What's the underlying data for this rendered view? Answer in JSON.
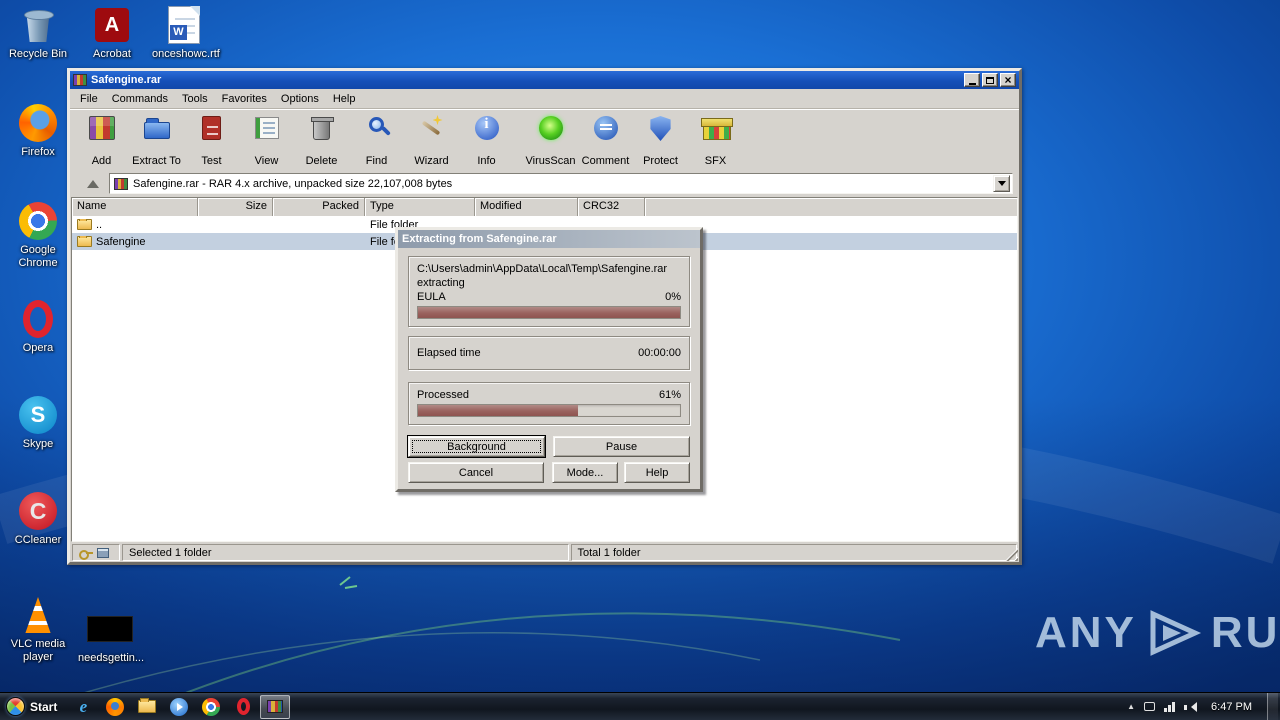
{
  "desktop": {
    "icons": [
      {
        "label": "Recycle Bin"
      },
      {
        "label": "Acrobat"
      },
      {
        "label": "onceshowc.rtf"
      },
      {
        "label": "Firefox"
      },
      {
        "label": "Google Chrome"
      },
      {
        "label": "Opera"
      },
      {
        "label": "Skype"
      },
      {
        "label": "CCleaner"
      },
      {
        "label": "VLC media player"
      },
      {
        "label": "needsgettin..."
      }
    ],
    "watermark_left": "ANY",
    "watermark_right": "RUN"
  },
  "winrar": {
    "title": "Safengine.rar",
    "menu": [
      "File",
      "Commands",
      "Tools",
      "Favorites",
      "Options",
      "Help"
    ],
    "toolbar": [
      "Add",
      "Extract To",
      "Test",
      "View",
      "Delete",
      "Find",
      "Wizard",
      "Info",
      "VirusScan",
      "Comment",
      "Protect",
      "SFX"
    ],
    "address": "Safengine.rar - RAR 4.x archive, unpacked size 22,107,008 bytes",
    "columns": [
      "Name",
      "Size",
      "Packed",
      "Type",
      "Modified",
      "CRC32"
    ],
    "rows": [
      {
        "name": "..",
        "type": "File folder"
      },
      {
        "name": "Safengine",
        "type": "File folder"
      }
    ],
    "status_selected": "Selected 1 folder",
    "status_total": "Total 1 folder"
  },
  "dialog": {
    "title": "Extracting from Safengine.rar",
    "path": "C:\\Users\\admin\\AppData\\Local\\Temp\\Safengine.rar",
    "action": "extracting",
    "current_file": "EULA",
    "current_percent": "0%",
    "current_bar": 100,
    "elapsed_label": "Elapsed time",
    "elapsed_value": "00:00:00",
    "processed_label": "Processed",
    "processed_percent": "61%",
    "processed_bar": 61,
    "buttons": {
      "background": "Background",
      "pause": "Pause",
      "cancel": "Cancel",
      "mode": "Mode...",
      "help": "Help"
    }
  },
  "taskbar": {
    "start_label": "Start",
    "clock": "6:47 PM"
  },
  "colors": {
    "titlebar_blue": "#1550b8",
    "progress_fill": "#9a625e",
    "selection": "#c3d0e0",
    "classic_gray": "#d6d3ce"
  }
}
